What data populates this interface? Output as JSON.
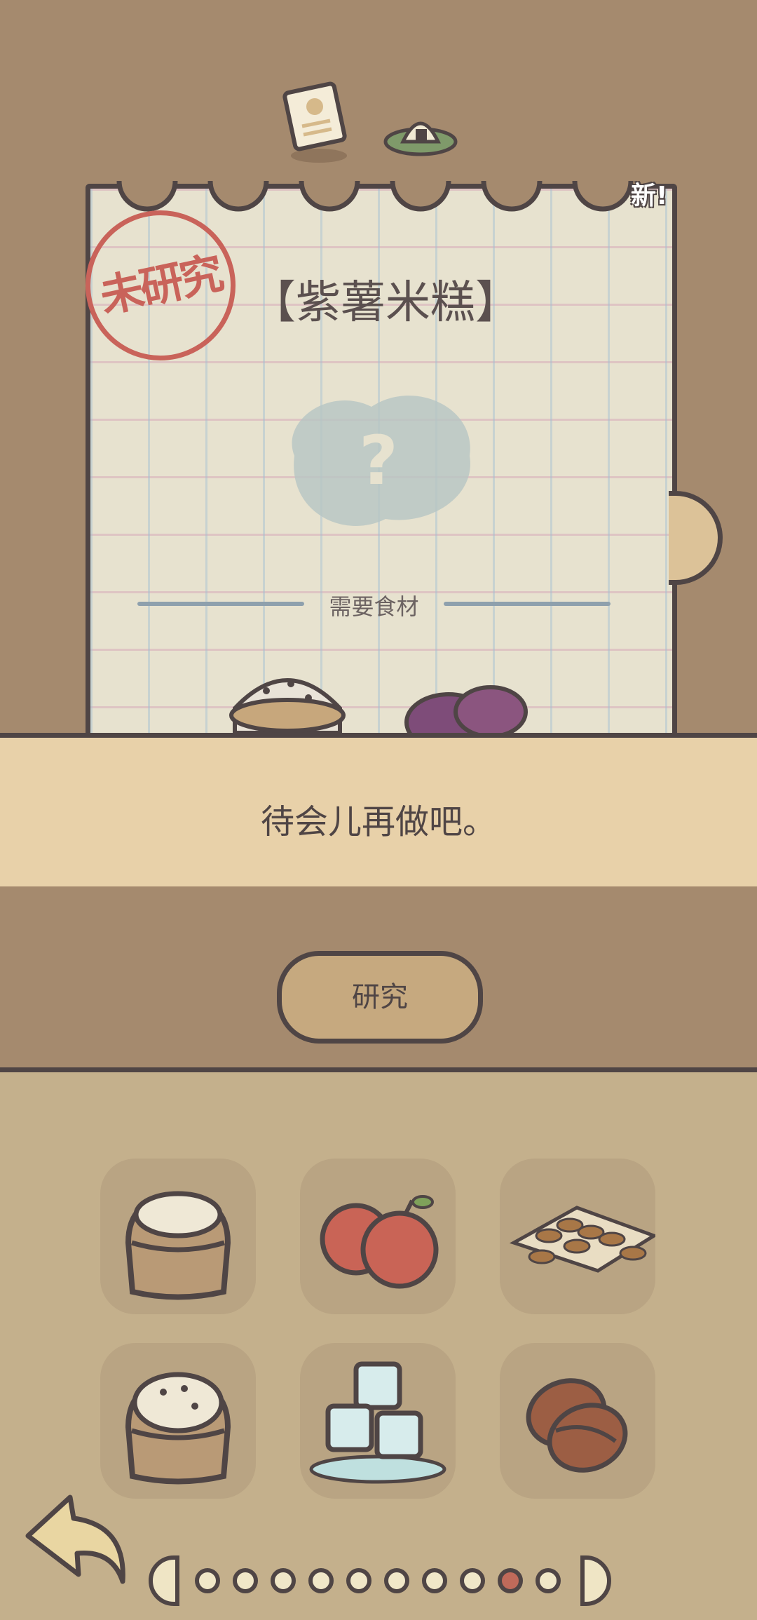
{
  "card": {
    "stamp": "未研究",
    "title": "【紫薯米糕】",
    "new_badge": "新!",
    "ingredients_label": "需要食材"
  },
  "dialog": {
    "text": "待会儿再做吧。"
  },
  "actions": {
    "research_label": "研究"
  },
  "ingredients_grid": [
    {
      "icon": "flour-sack-icon"
    },
    {
      "icon": "apples-icon"
    },
    {
      "icon": "nuts-icon"
    },
    {
      "icon": "rice-sack-icon"
    },
    {
      "icon": "ice-cubes-icon"
    },
    {
      "icon": "cocoa-beans-icon"
    }
  ],
  "pager": {
    "pages": 10,
    "current_page": 9
  },
  "colors": {
    "background": "#a58a6e",
    "paper": "#e7e2cf",
    "stamp": "#c9635a",
    "dialog": "#e8d1a9",
    "panel": "#c4b08c",
    "outline": "#4f4545",
    "active_dot": "#c06a5a"
  }
}
